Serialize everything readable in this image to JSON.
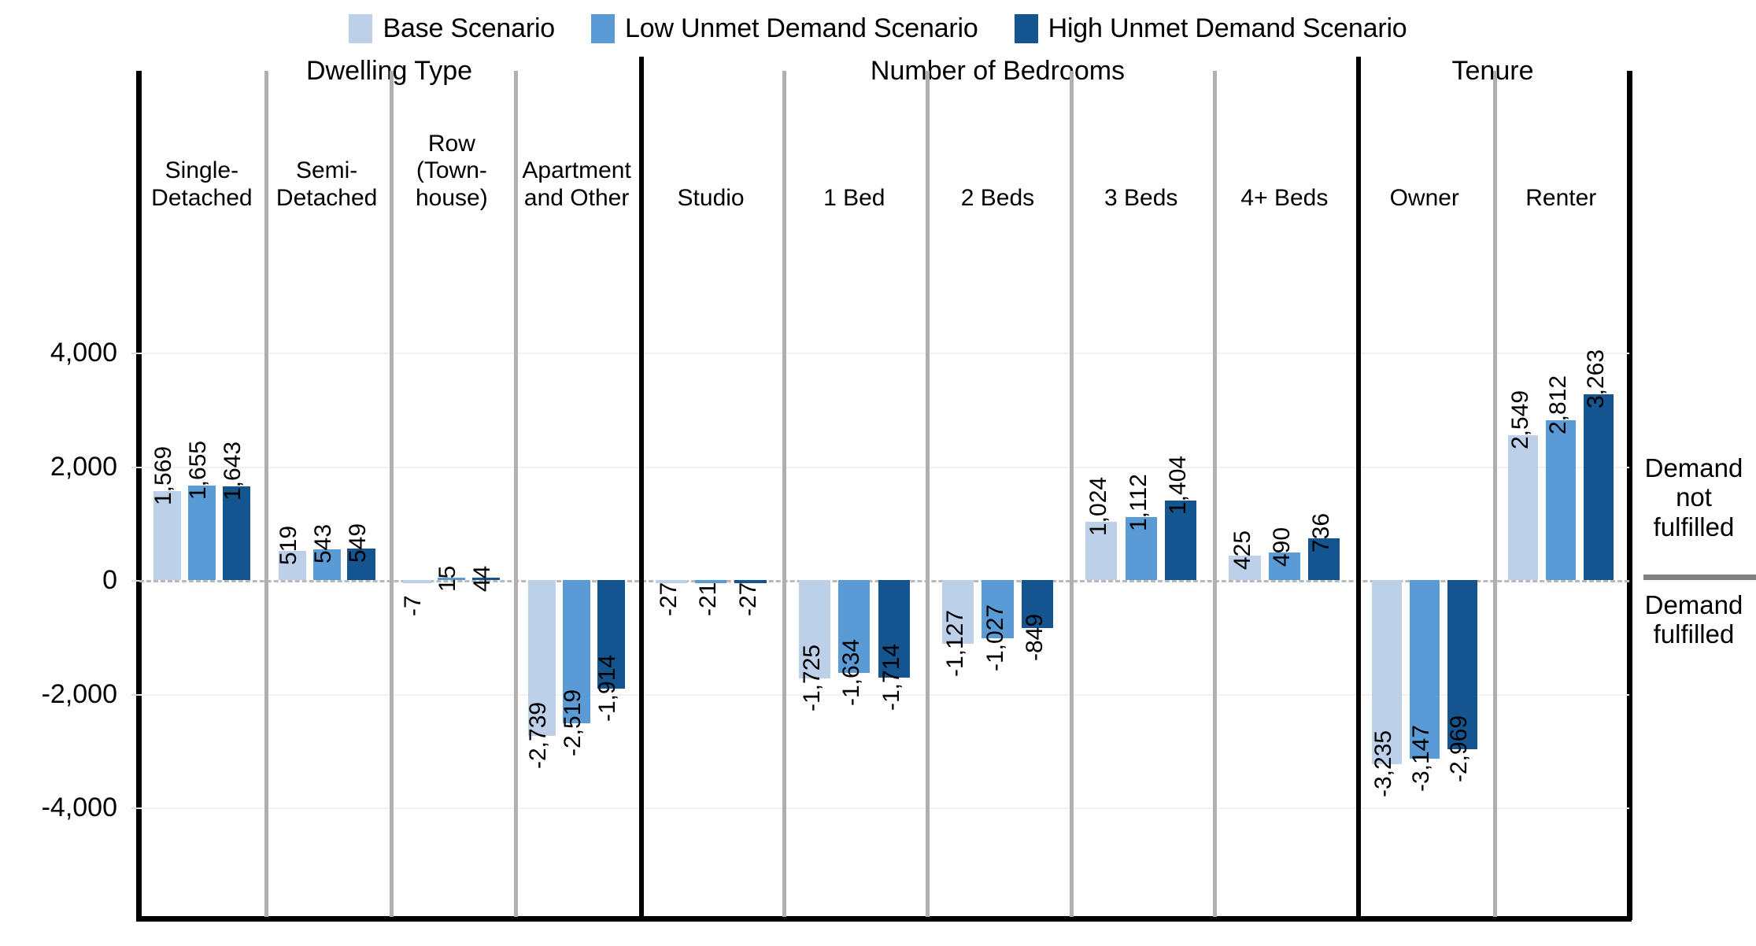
{
  "legend": {
    "items": [
      {
        "label": "Base Scenario",
        "color": "#bdd0e9"
      },
      {
        "label": "Low Unmet Demand Scenario",
        "color": "#5b9bd5"
      },
      {
        "label": "High Unmet Demand Scenario",
        "color": "#14558f"
      }
    ]
  },
  "annotations": {
    "above": "Demand\nnot\nfulfilled",
    "above_line1": "Demand",
    "above_line2": "not",
    "above_line3": "fulfilled",
    "below_line1": "Demand",
    "below_line2": "fulfilled"
  },
  "axis": {
    "y_ticks": [
      "4,000",
      "2,000",
      "0",
      "-2,000",
      "-4,000"
    ],
    "y_values": [
      4000,
      2000,
      0,
      -2000,
      -4000
    ],
    "y_min": -4800,
    "y_max": 5300
  },
  "sections": [
    {
      "title": "Dwelling Type",
      "categories": [
        "Single-\nDetached",
        "Semi-\nDetached",
        "Row\n(Town-\nhouse)",
        "Apartment\nand Other"
      ]
    },
    {
      "title": "Number of Bedrooms",
      "categories": [
        "Studio",
        "1 Bed",
        "2 Beds",
        "3 Beds",
        "4+ Beds"
      ]
    },
    {
      "title": "Tenure",
      "categories": [
        "Owner",
        "Renter"
      ]
    }
  ],
  "chart_data": {
    "type": "bar",
    "title": "",
    "xlabel": "",
    "ylabel": "",
    "ylim": [
      -4800,
      5300
    ],
    "grid": true,
    "legend_position": "top-center",
    "groups": [
      {
        "section": "Dwelling Type",
        "category": "Single-Detached",
        "label_lines": [
          "Single-",
          "Detached"
        ]
      },
      {
        "section": "Dwelling Type",
        "category": "Semi-Detached",
        "label_lines": [
          "Semi-",
          "Detached"
        ]
      },
      {
        "section": "Dwelling Type",
        "category": "Row (Town-house)",
        "label_lines": [
          "Row",
          "(Town-",
          "house)"
        ]
      },
      {
        "section": "Dwelling Type",
        "category": "Apartment and Other",
        "label_lines": [
          "Apartment",
          "and Other"
        ]
      },
      {
        "section": "Number of Bedrooms",
        "category": "Studio",
        "label_lines": [
          "Studio"
        ]
      },
      {
        "section": "Number of Bedrooms",
        "category": "1 Bed",
        "label_lines": [
          "1 Bed"
        ]
      },
      {
        "section": "Number of Bedrooms",
        "category": "2 Beds",
        "label_lines": [
          "2 Beds"
        ]
      },
      {
        "section": "Number of Bedrooms",
        "category": "3 Beds",
        "label_lines": [
          "3 Beds"
        ]
      },
      {
        "section": "Number of Bedrooms",
        "category": "4+ Beds",
        "label_lines": [
          "4+ Beds"
        ]
      },
      {
        "section": "Tenure",
        "category": "Owner",
        "label_lines": [
          "Owner"
        ]
      },
      {
        "section": "Tenure",
        "category": "Renter",
        "label_lines": [
          "Renter"
        ]
      }
    ],
    "categories": [
      "Single-Detached",
      "Semi-Detached",
      "Row (Town-house)",
      "Apartment and Other",
      "Studio",
      "1 Bed",
      "2 Beds",
      "3 Beds",
      "4+ Beds",
      "Owner",
      "Renter"
    ],
    "series": [
      {
        "name": "Base Scenario",
        "color": "#bdd0e9",
        "values": [
          1569,
          519,
          -7,
          -2739,
          -27,
          -1725,
          -1127,
          1024,
          425,
          -3235,
          2549
        ],
        "labels": [
          "1,569",
          "519",
          "-7",
          "-2,739",
          "-27",
          "-1,725",
          "-1,127",
          "1,024",
          "425",
          "-3,235",
          "2,549"
        ]
      },
      {
        "name": "Low Unmet Demand Scenario",
        "color": "#5b9bd5",
        "values": [
          1655,
          543,
          15,
          -2519,
          -21,
          -1634,
          -1027,
          1112,
          490,
          -3147,
          2812
        ],
        "labels": [
          "1,655",
          "543",
          "15",
          "-2,519",
          "-21",
          "-1,634",
          "-1,027",
          "1,112",
          "490",
          "-3,147",
          "2,812"
        ]
      },
      {
        "name": "High Unmet Demand Scenario",
        "color": "#14558f",
        "values": [
          1643,
          549,
          44,
          -1914,
          -27,
          -1714,
          -849,
          1404,
          736,
          -2969,
          3263
        ],
        "labels": [
          "1,643",
          "549",
          "44",
          "-1,914",
          "-27",
          "-1,714",
          "-849",
          "1,404",
          "736",
          "-2,969",
          "3,263"
        ]
      }
    ]
  }
}
